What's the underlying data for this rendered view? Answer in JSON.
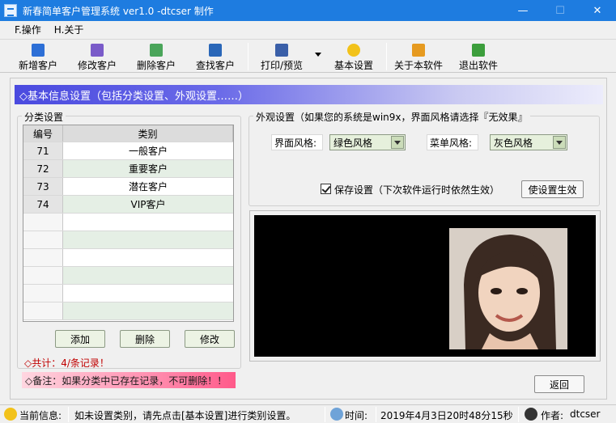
{
  "window": {
    "title": "新春简单客户管理系统 ver1.0  -dtcser 制作",
    "minimize": "—",
    "maximize": "☐",
    "close": "✕"
  },
  "menu": [
    {
      "label": "F.操作"
    },
    {
      "label": "H.关于"
    }
  ],
  "toolbar": {
    "add_customer": "新增客户",
    "edit_customer": "修改客户",
    "delete_customer": "删除客户",
    "find_customer": "查找客户",
    "print_preview": "打印/预览",
    "basic_settings": "基本设置",
    "about": "关于本软件",
    "exit": "退出软件"
  },
  "banner": "◇基本信息设置（包括分类设置、外观设置……）",
  "category": {
    "legend": "分类设置",
    "col_id": "编号",
    "col_name": "类别",
    "rows": [
      {
        "id": "71",
        "name": "一般客户"
      },
      {
        "id": "72",
        "name": "重要客户"
      },
      {
        "id": "73",
        "name": "潜在客户"
      },
      {
        "id": "74",
        "name": "VIP客户"
      }
    ],
    "add": "添加",
    "delete": "删除",
    "edit": "修改",
    "total": "◇共计：4/条记录！",
    "note": "◇备注：如果分类中已存在记录，不可删除！！"
  },
  "appearance": {
    "legend": "外观设置（如果您的系统是win9x，界面风格请选择『无效果』",
    "ui_style_label": "界面风格:",
    "ui_style_value": "绿色风格",
    "menu_style_label": "菜单风格:",
    "menu_style_value": "灰色风格",
    "save_label": "保存设置（下次软件运行时依然生效）",
    "save_checked": true,
    "apply": "使设置生效"
  },
  "back": "返回",
  "status": {
    "info_label": "当前信息:",
    "info_text": "如未设置类别，请先点击[基本设置]进行类别设置。",
    "time_label": "时间:",
    "time_value": "2019年4月3日20时48分15秒",
    "author_label": "作者:",
    "author_value": "dtcser"
  },
  "colors": {
    "titlebar": "#1e7ce0",
    "banner_start": "#4a4adf",
    "accent_red": "#c00000",
    "note_pink": "#ff5a8a"
  }
}
